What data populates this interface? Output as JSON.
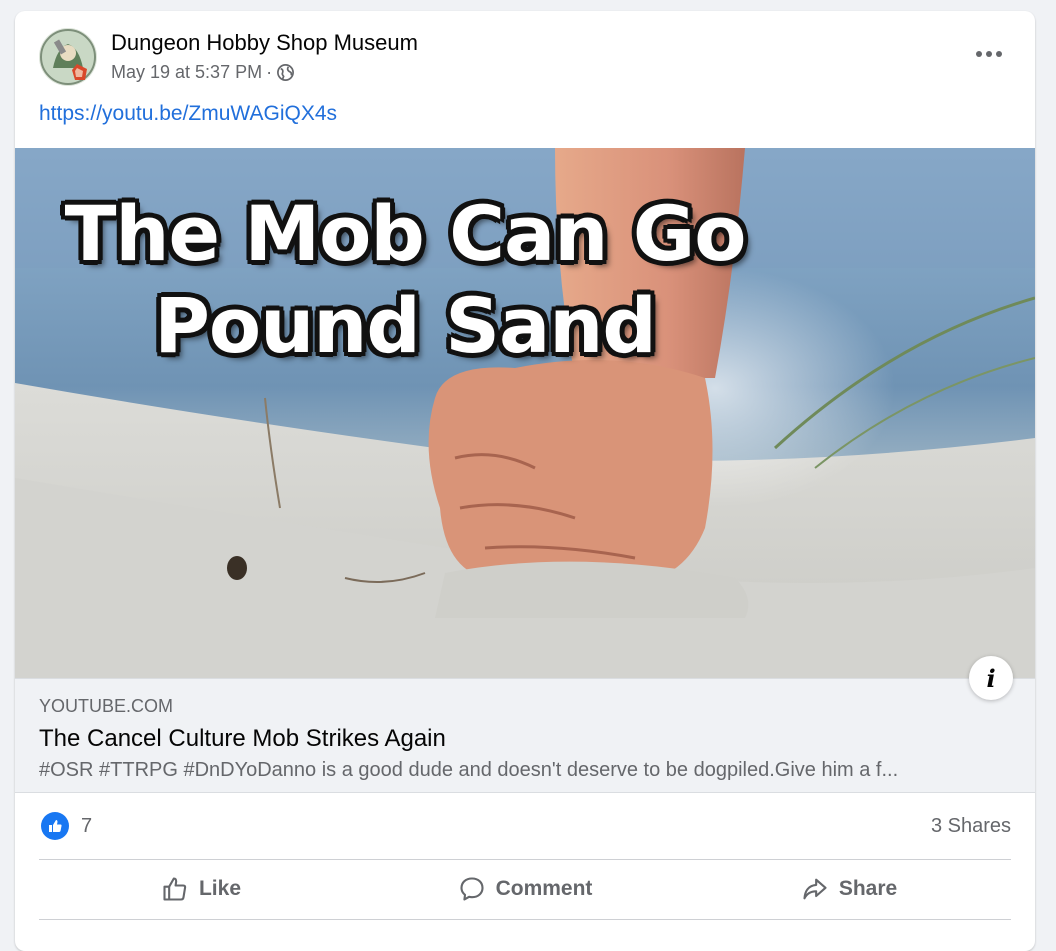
{
  "post": {
    "page_name": "Dungeon Hobby Shop Museum",
    "timestamp": "May 19 at 5:37 PM",
    "separator": "·",
    "privacy_icon": "globe-icon",
    "menu_icon": "more-horizontal-icon",
    "link_text": "https://youtu.be/ZmuWAGiQX4s"
  },
  "preview": {
    "thumbnail_title_line1": "The Mob Can Go",
    "thumbnail_title_line2": "Pound Sand",
    "info_label": "i",
    "domain": "YOUTUBE.COM",
    "title": "The Cancel Culture Mob Strikes Again",
    "description": "#OSR #TTRPG #DnDYoDanno is a good dude and doesn't deserve to be dogpiled.Give him a f..."
  },
  "stats": {
    "reaction_icon": "like-reaction-icon",
    "like_count": "7",
    "shares": "3 Shares"
  },
  "actions": {
    "like": "Like",
    "comment": "Comment",
    "share": "Share"
  },
  "colors": {
    "link_blue": "#216fdb",
    "like_blue": "#1877f2",
    "secondary_text": "#65676b"
  }
}
